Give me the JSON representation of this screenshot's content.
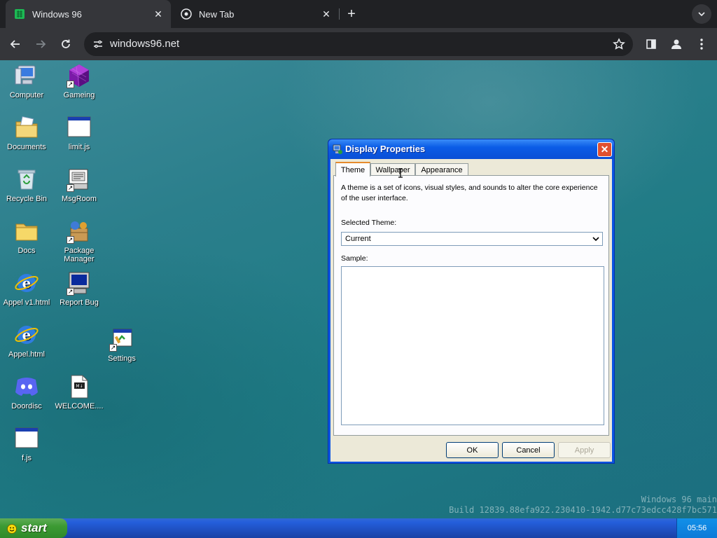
{
  "browser": {
    "tabs": [
      {
        "title": "Windows 96",
        "active": true
      },
      {
        "title": "New Tab",
        "active": false
      }
    ],
    "url": "windows96.net"
  },
  "desktop": {
    "icons": [
      {
        "label": "Computer",
        "icon": "computer-icon"
      },
      {
        "label": "Gameing",
        "icon": "game-cube-icon"
      },
      {
        "label": "Documents",
        "icon": "documents-folder-icon"
      },
      {
        "label": "limit.js",
        "icon": "window-file-icon"
      },
      {
        "label": "Recycle Bin",
        "icon": "recycle-bin-icon"
      },
      {
        "label": "MsgRoom",
        "icon": "msgroom-icon"
      },
      {
        "label": "Docs",
        "icon": "folder-icon"
      },
      {
        "label": "Package Manager",
        "icon": "package-manager-icon"
      },
      {
        "label": "Appel v1.html",
        "icon": "browser-icon"
      },
      {
        "label": "Report Bug",
        "icon": "report-bug-icon"
      },
      {
        "label": "Appel.html",
        "icon": "browser-icon"
      },
      {
        "label": "Settings",
        "icon": "settings-icon"
      },
      {
        "label": "Doordisc",
        "icon": "doordisc-icon"
      },
      {
        "label": "WELCOME....",
        "icon": "markdown-file-icon"
      },
      {
        "label": "f.js",
        "icon": "window-file-icon"
      }
    ],
    "build_line1": "Windows 96 main",
    "build_line2": "Build 12839.88efa922.230410-1942.d77c73edcc428f7bc571"
  },
  "dialog": {
    "title": "Display Properties",
    "tabs": [
      "Theme",
      "Wallpaper",
      "Appearance"
    ],
    "active_tab": "Theme",
    "description": "A theme is a set of icons, visual styles, and sounds to alter the core experience of the user interface.",
    "selected_theme_label": "Selected Theme:",
    "selected_theme_value": "Current",
    "sample_label": "Sample:",
    "buttons": {
      "ok": "OK",
      "cancel": "Cancel",
      "apply": "Apply"
    }
  },
  "taskbar": {
    "start_label": "start",
    "clock": "05:56"
  },
  "colors": {
    "desktop": "#2b7f8c",
    "title_bar": "#0b5ce6",
    "dialog_face": "#ece9d8",
    "taskbar": "#245edb",
    "start_button": "#3c9a33"
  }
}
